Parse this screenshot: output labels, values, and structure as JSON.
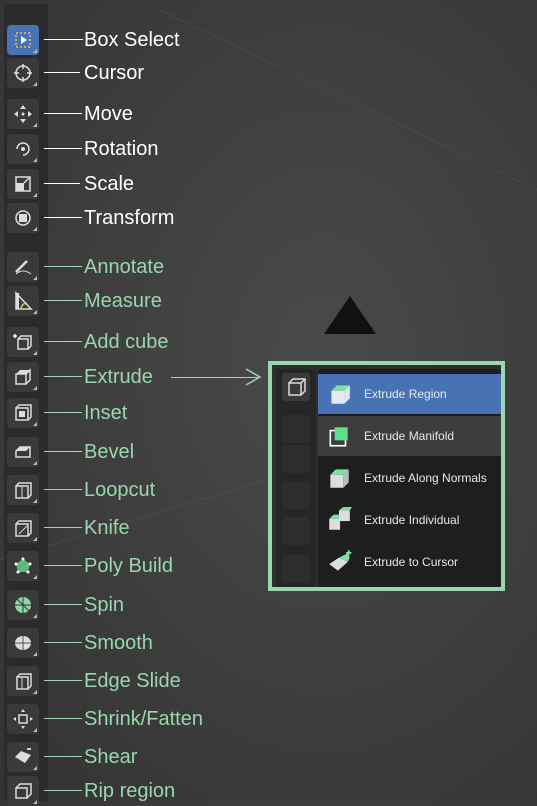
{
  "tools": [
    {
      "label": "Box Select",
      "icon": "box-select-icon",
      "group": "white",
      "active": true
    },
    {
      "label": "Cursor",
      "icon": "cursor-icon",
      "group": "white"
    },
    {
      "label": "Move",
      "icon": "move-icon",
      "group": "white"
    },
    {
      "label": "Rotation",
      "icon": "rotate-icon",
      "group": "white"
    },
    {
      "label": "Scale",
      "icon": "scale-icon",
      "group": "white"
    },
    {
      "label": "Transform",
      "icon": "transform-icon",
      "group": "white"
    },
    {
      "label": "Annotate",
      "icon": "annotate-icon",
      "group": "green"
    },
    {
      "label": "Measure",
      "icon": "measure-icon",
      "group": "green"
    },
    {
      "label": "Add cube",
      "icon": "add-cube-icon",
      "group": "green"
    },
    {
      "label": "Extrude",
      "icon": "extrude-icon",
      "group": "green"
    },
    {
      "label": "Inset",
      "icon": "inset-icon",
      "group": "green"
    },
    {
      "label": "Bevel",
      "icon": "bevel-icon",
      "group": "green"
    },
    {
      "label": "Loopcut",
      "icon": "loopcut-icon",
      "group": "green"
    },
    {
      "label": "Knife",
      "icon": "knife-icon",
      "group": "green"
    },
    {
      "label": "Poly Build",
      "icon": "poly-build-icon",
      "group": "green"
    },
    {
      "label": "Spin",
      "icon": "spin-icon",
      "group": "green"
    },
    {
      "label": "Smooth",
      "icon": "smooth-icon",
      "group": "green"
    },
    {
      "label": "Edge Slide",
      "icon": "edge-slide-icon",
      "group": "green"
    },
    {
      "label": "Shrink/Fatten",
      "icon": "shrink-fatten-icon",
      "group": "green"
    },
    {
      "label": "Shear",
      "icon": "shear-icon",
      "group": "green"
    },
    {
      "label": "Rip region",
      "icon": "rip-region-icon",
      "group": "green"
    }
  ],
  "extrude_menu": {
    "items": [
      {
        "label": "Extrude Region",
        "icon": "extrude-region-icon",
        "state": "highlight"
      },
      {
        "label": "Extrude Manifold",
        "icon": "extrude-manifold-icon",
        "state": "hover"
      },
      {
        "label": "Extrude Along Normals",
        "icon": "extrude-along-normals-icon",
        "state": ""
      },
      {
        "label": "Extrude Individual",
        "icon": "extrude-individual-icon",
        "state": ""
      },
      {
        "label": "Extrude to Cursor",
        "icon": "extrude-to-cursor-icon",
        "state": ""
      }
    ]
  },
  "colors": {
    "annotation_white": "#ffffff",
    "annotation_green": "#9ad6b0",
    "active_blue": "#4772b3"
  }
}
